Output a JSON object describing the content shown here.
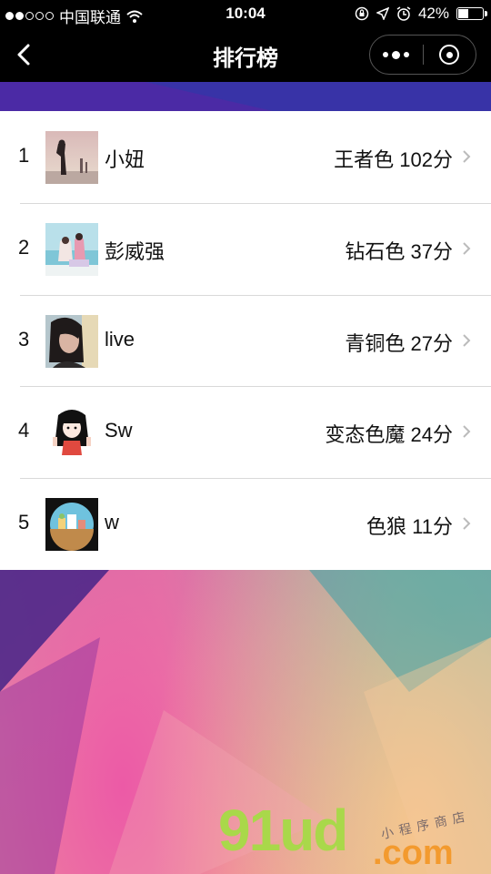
{
  "status_bar": {
    "carrier": "中国联通",
    "time": "10:04",
    "battery": "42%",
    "battery_level": 0.42
  },
  "nav": {
    "title": "排行榜"
  },
  "ranking": [
    {
      "rank": "1",
      "name": "小妞",
      "score": "王者色 102分"
    },
    {
      "rank": "2",
      "name": "彭威强",
      "score": "钻石色 37分"
    },
    {
      "rank": "3",
      "name": "live",
      "score": "青铜色 27分"
    },
    {
      "rank": "4",
      "name": "Sw",
      "score": "变态色魔 24分"
    },
    {
      "rank": "5",
      "name": "w",
      "score": "色狼 11分"
    }
  ],
  "watermark": {
    "logo": "91ud",
    "domain": ".com",
    "tagline": "小程序商店"
  },
  "colors": {
    "bar_bg": "#000000",
    "watermark_green": "#a9d84a",
    "watermark_orange": "#f39a2e"
  }
}
